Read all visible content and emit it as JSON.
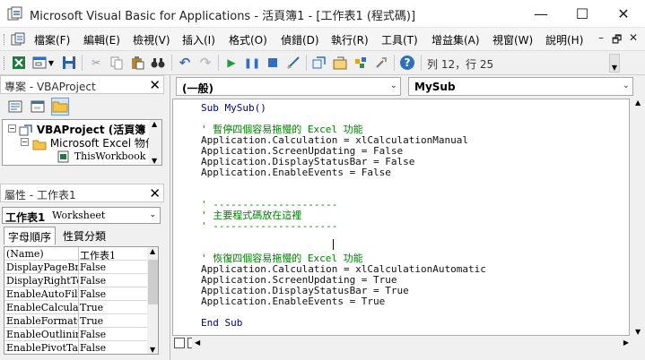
{
  "window": {
    "title": "Microsoft Visual Basic for Applications - 活頁簿1 - [工作表1 (程式碼)]",
    "minimize_glyph": "—",
    "maximize_glyph": "☐",
    "close_glyph": "✕"
  },
  "menubar": {
    "items": [
      "檔案(F)",
      "編輯(E)",
      "檢視(V)",
      "插入(I)",
      "格式(O)",
      "偵錯(D)",
      "執行(R)",
      "工具(T)",
      "增益集(A)",
      "視窗(W)",
      "說明(H)"
    ],
    "mdi": [
      "–",
      "🗗",
      "✕"
    ]
  },
  "toolbar": {
    "status": "列 12，行 25"
  },
  "project": {
    "title": "專案 - VBAProject",
    "close_glyph": "✕",
    "tree": [
      "VBAProject (活頁簿",
      "Microsoft Excel 物件",
      "ThisWorkbook"
    ]
  },
  "properties": {
    "title": "屬性 - 工作表1",
    "close_glyph": "✕",
    "object_name": "工作表1",
    "object_type": "Worksheet",
    "tabs": [
      "字母順序",
      "性質分類"
    ],
    "rows": [
      {
        "name": "(Name)",
        "value": "工作表1"
      },
      {
        "name": "DisplayPageBreaks",
        "value": "False"
      },
      {
        "name": "DisplayRightToLeft",
        "value": "False"
      },
      {
        "name": "EnableAutoFilter",
        "value": "False"
      },
      {
        "name": "EnableCalculation",
        "value": "True"
      },
      {
        "name": "EnableFormatConditionsCalculation",
        "value": "True"
      },
      {
        "name": "EnableOutlining",
        "value": "False"
      },
      {
        "name": "EnablePivotTable",
        "value": "False"
      }
    ]
  },
  "code": {
    "object_combo": "(一般)",
    "proc_combo": "MySub",
    "lines": [
      {
        "text": "Sub MySub()",
        "kind": "kw"
      },
      {
        "text": "",
        "kind": "plain"
      },
      {
        "text": "' 暫停四個容易拖慢的 Excel 功能",
        "kind": "comment"
      },
      {
        "text": "Application.Calculation = xlCalculationManual",
        "kind": "plain"
      },
      {
        "text": "Application.ScreenUpdating = False",
        "kind": "plain"
      },
      {
        "text": "Application.DisplayStatusBar = False",
        "kind": "plain"
      },
      {
        "text": "Application.EnableEvents = False",
        "kind": "plain"
      },
      {
        "text": "",
        "kind": "plain"
      },
      {
        "text": "",
        "kind": "plain"
      },
      {
        "text": "' ---------------------",
        "kind": "comment"
      },
      {
        "text": "' 主要程式碼放在這裡",
        "kind": "comment"
      },
      {
        "text": "' ---------------------",
        "kind": "comment"
      },
      {
        "text": "",
        "kind": "plain"
      },
      {
        "text": "",
        "kind": "plain"
      },
      {
        "text": "' 恢復四個容易拖慢的 Excel 功能",
        "kind": "comment"
      },
      {
        "text": "Application.Calculation = xlCalculationAutomatic",
        "kind": "plain"
      },
      {
        "text": "Application.ScreenUpdating = True",
        "kind": "plain"
      },
      {
        "text": "Application.DisplayStatusBar = True",
        "kind": "plain"
      },
      {
        "text": "Application.EnableEvents = True",
        "kind": "plain"
      },
      {
        "text": "",
        "kind": "plain"
      },
      {
        "text": "End Sub",
        "kind": "kw"
      }
    ]
  }
}
